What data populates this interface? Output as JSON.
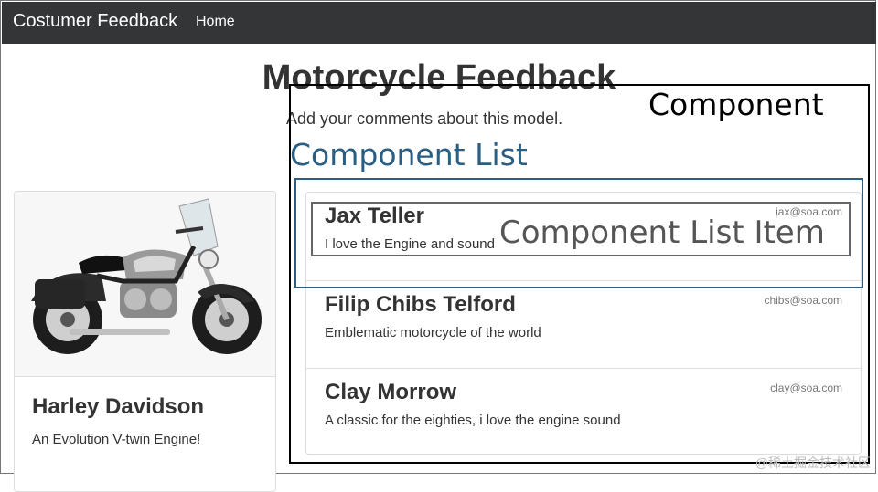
{
  "navbar": {
    "brand": "Costumer Feedback",
    "home_link": "Home"
  },
  "page": {
    "title": "Motorcycle Feedback",
    "subtitle": "Add your comments about this model."
  },
  "product": {
    "name": "Harley Davidson",
    "description": "An Evolution V-twin Engine!",
    "image_icon": "motorcycle-photo"
  },
  "feedback": [
    {
      "name": "Jax Teller",
      "email": "jax@soa.com",
      "comment": "I love the Engine and sound"
    },
    {
      "name": "Filip Chibs Telford",
      "email": "chibs@soa.com",
      "comment": "Emblematic motorcycle of the world"
    },
    {
      "name": "Clay Morrow",
      "email": "clay@soa.com",
      "comment": "A classic for the eighties, i love the engine sound"
    }
  ],
  "annotations": {
    "component": "Component",
    "component_list": "Component List",
    "component_list_item": "Component List Item"
  },
  "watermark": "@稀土掘金技术社区",
  "colors": {
    "navbar_bg": "#333537",
    "annotation_list": "#2a5e82",
    "annotation_item": "#666666"
  }
}
